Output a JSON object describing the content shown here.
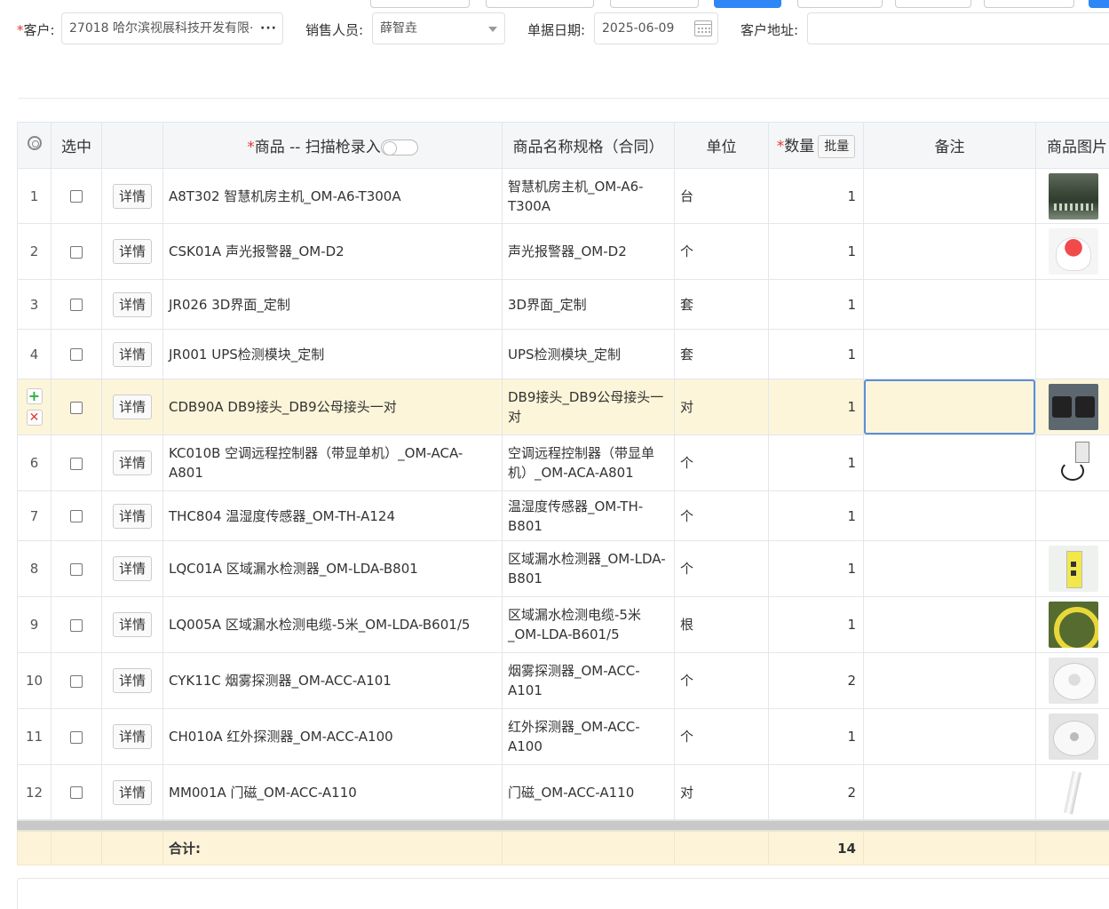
{
  "header": {
    "customer_label": "客户:",
    "customer_value": "27018 哈尔滨视展科技开发有限·",
    "customer_more": "···",
    "sales_label": "销售人员:",
    "sales_value": "薛智垚",
    "date_label": "单据日期:",
    "date_value": "2025-06-09",
    "address_label": "客户地址:",
    "address_value": ""
  },
  "table": {
    "headers": {
      "select": "选中",
      "product_prefix": "商品 -- 扫描枪录入",
      "spec": "商品名称规格（合同）",
      "unit": "单位",
      "qty": "数量",
      "batch_button": "批量",
      "remark": "备注",
      "image": "商品图片"
    },
    "detail_label": "详情",
    "rows": [
      {
        "no": "1",
        "product": "A8T302 智慧机房主机_OM-A6-T300A",
        "spec": "智慧机房主机_OM-A6-T300A",
        "unit": "台",
        "qty": "1",
        "remark": "",
        "image": "server-rack-photo"
      },
      {
        "no": "2",
        "product": "CSK01A 声光报警器_OM-D2",
        "spec": "声光报警器_OM-D2",
        "unit": "个",
        "qty": "1",
        "remark": "",
        "image": "alarm-photo"
      },
      {
        "no": "3",
        "product": "JR026 3D界面_定制",
        "spec": "3D界面_定制",
        "unit": "套",
        "qty": "1",
        "remark": "",
        "image": ""
      },
      {
        "no": "4",
        "product": "JR001 UPS检测模块_定制",
        "spec": "UPS检测模块_定制",
        "unit": "套",
        "qty": "1",
        "remark": "",
        "image": ""
      },
      {
        "no": "",
        "product": "CDB90A DB9接头_DB9公母接头一对",
        "spec": "DB9接头_DB9公母接头一对",
        "unit": "对",
        "qty": "1",
        "remark": "",
        "image": "db9-photo"
      },
      {
        "no": "6",
        "product": "KC010B 空调远程控制器（带显单机）_OM-ACA-A801",
        "spec": "空调远程控制器（带显单机）_OM-ACA-A801",
        "unit": "个",
        "qty": "1",
        "remark": "",
        "image": "controller-photo"
      },
      {
        "no": "7",
        "product": "THC804 温湿度传感器_OM-TH-A124",
        "spec": "温湿度传感器_OM-TH-B801",
        "unit": "个",
        "qty": "1",
        "remark": "",
        "image": ""
      },
      {
        "no": "8",
        "product": "LQC01A 区域漏水检测器_OM-LDA-B801",
        "spec": "区域漏水检测器_OM-LDA-B801",
        "unit": "个",
        "qty": "1",
        "remark": "",
        "image": "leak-detector-photo"
      },
      {
        "no": "9",
        "product": "LQ005A 区域漏水检测电缆-5米_OM-LDA-B601/5",
        "spec": "区域漏水检测电缆-5米_OM-LDA-B601/5",
        "unit": "根",
        "qty": "1",
        "remark": "",
        "image": "leak-cable-photo"
      },
      {
        "no": "10",
        "product": "CYK11C 烟雾探测器_OM-ACC-A101",
        "spec": "烟雾探测器_OM-ACC-A101",
        "unit": "个",
        "qty": "2",
        "remark": "",
        "image": "smoke-detector-photo"
      },
      {
        "no": "11",
        "product": "CH010A 红外探测器_OM-ACC-A100",
        "spec": "红外探测器_OM-ACC-A100",
        "unit": "个",
        "qty": "1",
        "remark": "",
        "image": "ir-detector-photo"
      },
      {
        "no": "12",
        "product": "MM001A 门磁_OM-ACC-A110",
        "spec": "门磁_OM-ACC-A110",
        "unit": "对",
        "qty": "2",
        "remark": "",
        "image": "door-sensor-photo"
      }
    ],
    "total_label": "合计:",
    "total_qty": "14"
  },
  "colors": {
    "required": "#e53935",
    "highlight_row": "#fcf5d9",
    "sum_row": "#fdf3d9",
    "primary": "#2f86f6",
    "add": "#2eae43",
    "delete": "#e53935"
  }
}
